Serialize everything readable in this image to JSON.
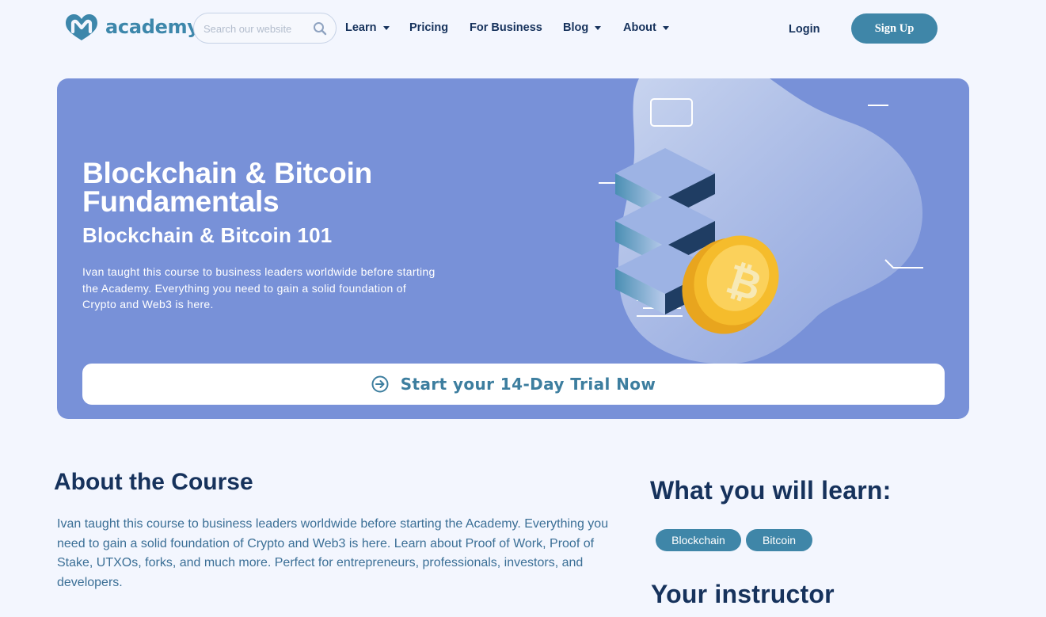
{
  "header": {
    "logo_text": "academy",
    "search_placeholder": "Search our website",
    "nav": {
      "learn": "Learn",
      "pricing": "Pricing",
      "for_business": "For Business",
      "blog": "Blog",
      "about": "About"
    },
    "login": "Login",
    "signup": "Sign Up"
  },
  "hero": {
    "title": "Blockchain & Bitcoin Fundamentals",
    "subtitle": "Blockchain & Bitcoin 101",
    "description": "Ivan taught this course to business leaders worldwide before starting the Academy. Everything you need to gain a solid foundation of Crypto and Web3 is here.",
    "cta_label": "Start your 14-Day Trial Now",
    "cta_icon": "arrow-circle-right-icon",
    "illustration_icons": [
      "server-stack-icon",
      "bitcoin-coin-icon"
    ]
  },
  "about": {
    "title": "About the Course",
    "description": "Ivan taught this course to business leaders worldwide before starting the Academy. Everything you need to gain a solid foundation of Crypto and Web3 is here. Learn about Proof of Work, Proof of Stake, UTXOs, forks, and much more. Perfect for entrepreneurs, professionals, investors, and developers."
  },
  "learn": {
    "title": "What you will learn:",
    "tags": [
      "Blockchain",
      "Bitcoin"
    ]
  },
  "instructor": {
    "title": "Your instructor"
  },
  "colors": {
    "page_bg": "#f3f6fe",
    "hero_bg": "#7891d8",
    "accent": "#3f86a8",
    "heading": "#16325c",
    "body_text": "#3b6f96",
    "coin": "#f5bc2c"
  }
}
